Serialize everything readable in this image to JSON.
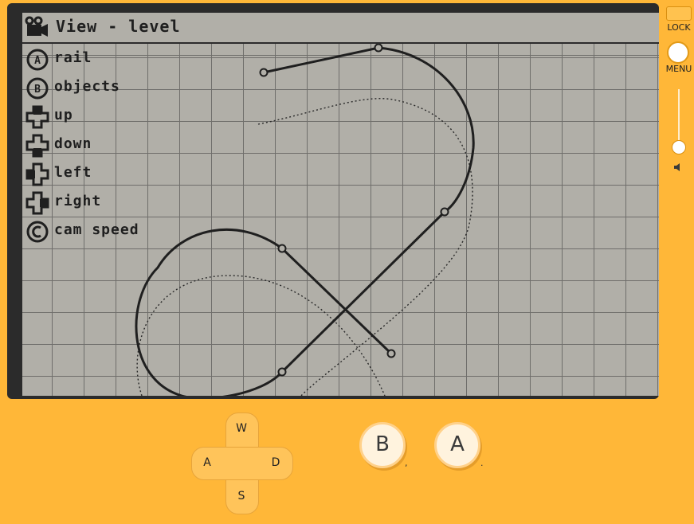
{
  "screen": {
    "title": "View - level",
    "controls": [
      {
        "label": "rail",
        "icon": "a-button-icon"
      },
      {
        "label": "objects",
        "icon": "b-button-icon"
      },
      {
        "label": "up",
        "icon": "dpad-up-icon"
      },
      {
        "label": "down",
        "icon": "dpad-down-icon"
      },
      {
        "label": "left",
        "icon": "dpad-left-icon"
      },
      {
        "label": "right",
        "icon": "dpad-right-icon"
      },
      {
        "label": "cam speed",
        "icon": "crank-icon"
      }
    ],
    "icons": {
      "title": "camera-icon"
    }
  },
  "side": {
    "lock_label": "LOCK",
    "menu_label": "MENU"
  },
  "dpad": {
    "up": "W",
    "left": "A",
    "right": "D",
    "down": "S"
  },
  "buttons": {
    "b_label": "B",
    "a_label": "A",
    "b_key": ",",
    "a_key": "."
  },
  "colors": {
    "body": "#ffb738",
    "screen": "#b1afa8",
    "ink": "#1f1f1f",
    "frame": "#2b2b2b"
  }
}
